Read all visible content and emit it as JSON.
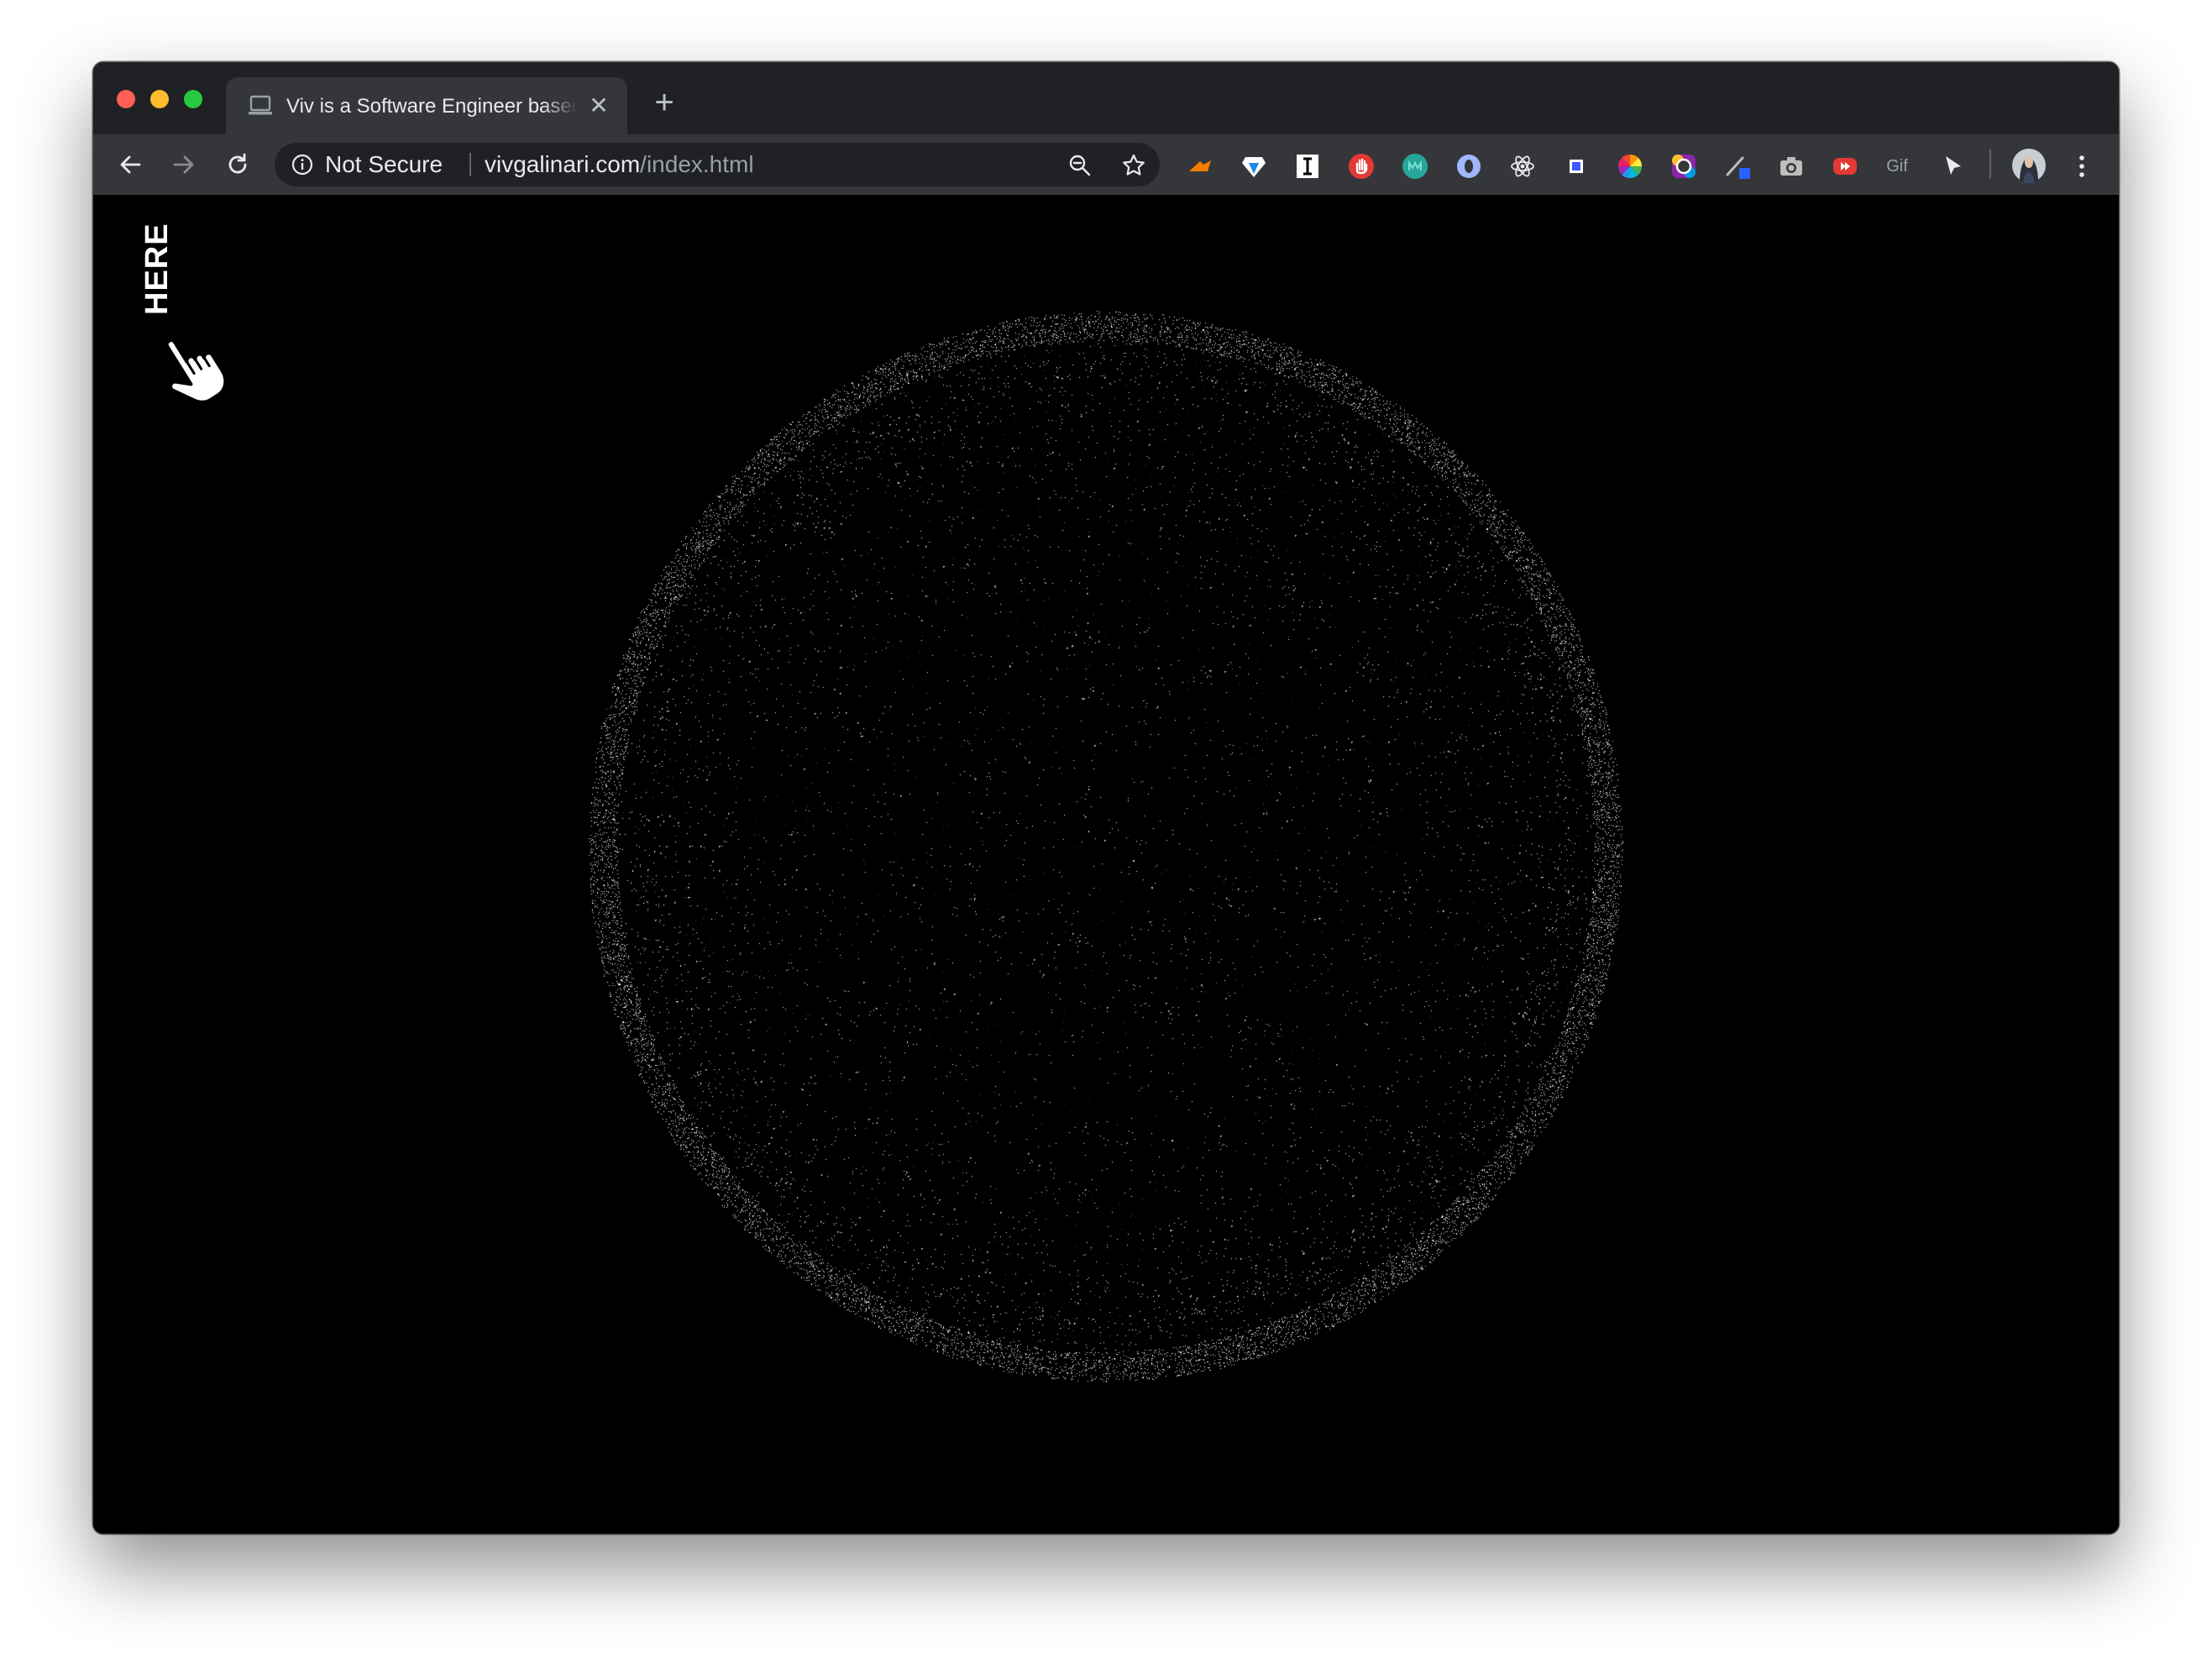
{
  "browser": {
    "tab": {
      "title": "Viv is a Software Engineer based in Chicago",
      "favicon": "laptop-icon",
      "close_icon": "close-icon"
    },
    "new_tab_icon": "plus-icon",
    "nav": {
      "back_icon": "back-arrow-icon",
      "forward_icon": "forward-arrow-icon",
      "reload_icon": "reload-icon"
    },
    "omnibox": {
      "security_label": "Not Secure",
      "url_host": "vivgalinari.com",
      "url_path": "/index.html"
    },
    "extensions": [
      {
        "name": "orange-arrow-extension-icon",
        "color": "#f57c00"
      },
      {
        "name": "diamond-extension-icon",
        "color": "#4aa3ff"
      },
      {
        "name": "i-extension-icon",
        "color": "#ffffff"
      },
      {
        "name": "red-hand-extension-icon",
        "color": "#e53935"
      },
      {
        "name": "teal-m-extension-icon",
        "color": "#26a69a"
      },
      {
        "name": "ring-extension-icon",
        "color": "#9fb7ff"
      },
      {
        "name": "react-atom-extension-icon",
        "color": "#e8eaed"
      },
      {
        "name": "square-extension-icon",
        "color": "#3d5afe"
      },
      {
        "name": "color-wheel-extension-icon",
        "color": "#ff9800"
      },
      {
        "name": "rainbow-ring-extension-icon",
        "color": "#8e24aa"
      },
      {
        "name": "eyedropper-extension-icon",
        "color": "#2962ff"
      },
      {
        "name": "camera-extension-icon",
        "color": "#bdbdbd"
      },
      {
        "name": "red-play-extension-icon",
        "color": "#e53935"
      },
      {
        "name": "gif-extension-icon",
        "color": "#9aa0a6",
        "label": "Gif"
      },
      {
        "name": "cursor-extension-icon",
        "color": "#e8eaed"
      }
    ],
    "avatar_icon": "profile-avatar-icon",
    "menu_icon": "kebab-menu-icon"
  },
  "page": {
    "here_label": "HERE",
    "pointer_icon": "pointing-hand-icon",
    "particle_color": "#d8dcd8",
    "background_color": "#000000"
  }
}
